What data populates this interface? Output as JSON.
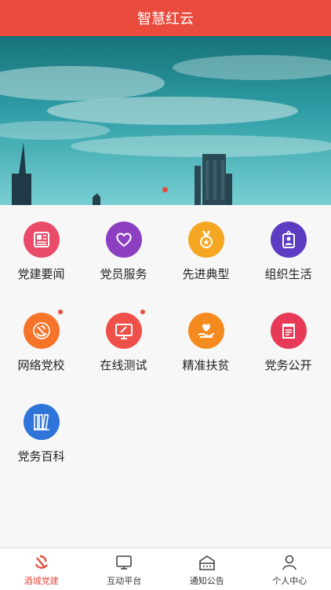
{
  "header": {
    "title": "智慧红云"
  },
  "banner": {
    "pager_count": 1,
    "active_index": 0
  },
  "grid": {
    "items": [
      {
        "label": "党建要闻",
        "icon": "newspaper-icon",
        "color": "#e94b68",
        "badge": false
      },
      {
        "label": "党员服务",
        "icon": "heart-icon",
        "color": "#8c3fc0",
        "badge": false
      },
      {
        "label": "先进典型",
        "icon": "medal-icon",
        "color": "#f5a623",
        "badge": false
      },
      {
        "label": "组织生活",
        "icon": "id-card-icon",
        "color": "#5b3cc2",
        "badge": false
      },
      {
        "label": "网络党校",
        "icon": "party-emblem-icon",
        "color": "#f5742a",
        "badge": true
      },
      {
        "label": "在线测试",
        "icon": "monitor-pen-icon",
        "color": "#f0504a",
        "badge": true
      },
      {
        "label": "精准扶贫",
        "icon": "hand-heart-icon",
        "color": "#f58a1f",
        "badge": false
      },
      {
        "label": "党务公开",
        "icon": "notice-board-icon",
        "color": "#e63a56",
        "badge": false
      },
      {
        "label": "党务百科",
        "icon": "books-icon",
        "color": "#2f74d8",
        "badge": false
      }
    ]
  },
  "tabbar": {
    "tabs": [
      {
        "label": "酒城党建",
        "icon": "party-emblem-icon",
        "active": true
      },
      {
        "label": "互动平台",
        "icon": "monitor-icon",
        "active": false
      },
      {
        "label": "通知公告",
        "icon": "notice-house-icon",
        "active": false
      },
      {
        "label": "个人中心",
        "icon": "person-icon",
        "active": false
      }
    ]
  }
}
